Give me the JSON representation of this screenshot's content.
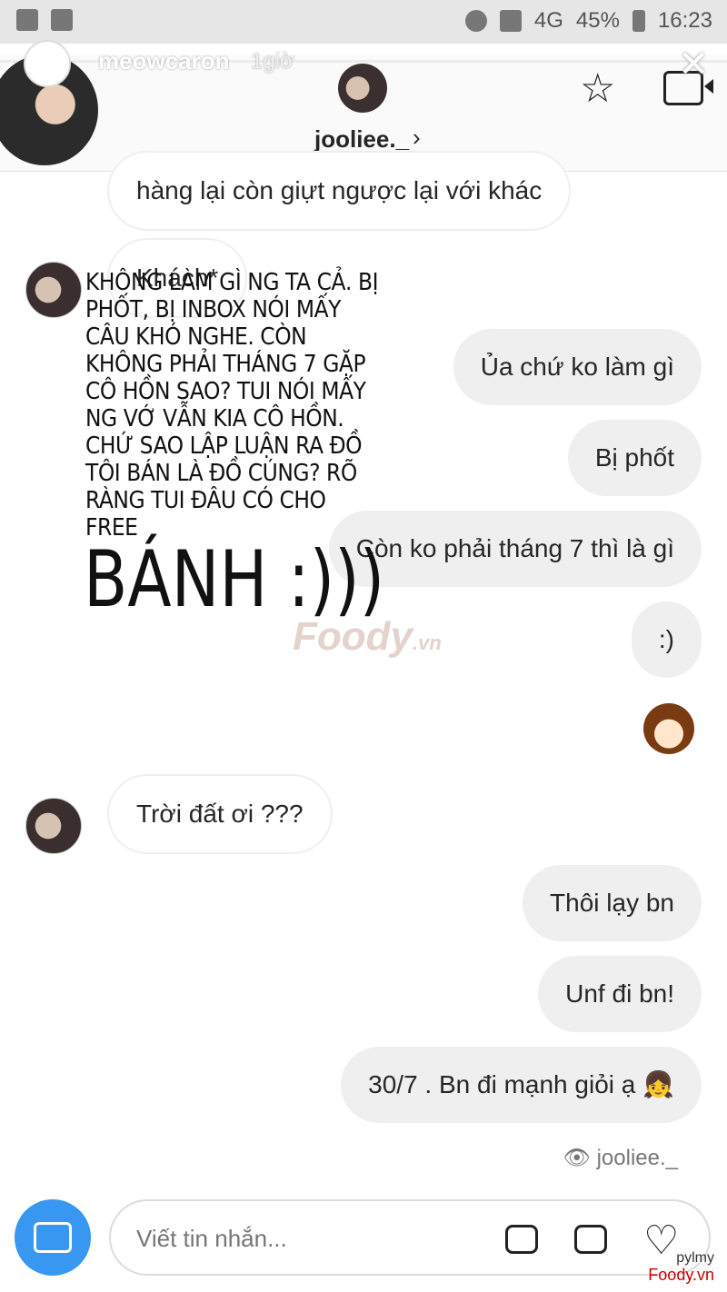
{
  "status_bar": {
    "battery": "45%",
    "time": "16:23",
    "network": "4G"
  },
  "story": {
    "username": "meowcaron",
    "time_ago": "1giờ",
    "close_icon": "close-icon",
    "logo_text": "meowcaron"
  },
  "header": {
    "username": "jooliee._",
    "chevron": "›",
    "star_icon": "star-icon",
    "video_icon": "video-camera-icon"
  },
  "messages": [
    {
      "side": "in",
      "text": "hàng lại còn giựt ngược lại với khác"
    },
    {
      "side": "in",
      "text": "Khách*"
    },
    {
      "side": "out",
      "text": "Ủa chứ ko làm gì"
    },
    {
      "side": "out",
      "text": "Bị phốt"
    },
    {
      "side": "out",
      "text": "Còn ko phải tháng 7 thì là gì"
    },
    {
      "side": "out",
      "text": ":)"
    },
    {
      "side": "out",
      "sticker": "girl-sticker"
    },
    {
      "side": "in",
      "text": "Trời đất ơi ???"
    },
    {
      "side": "out",
      "text": "Thôi lạy bn"
    },
    {
      "side": "out",
      "text": "Unf đi bn!"
    },
    {
      "side": "out",
      "text": "30/7 . Bn đi mạnh giỏi ạ 👧"
    }
  ],
  "overlay": {
    "caption": "Không làm gì ng ta cả. Bị phốt, bị inbox nói mấy câu khó nghe. Còn không phải tháng 7 gặp cô hồn sao? Tui nói mấy ng vớ vẫn kia cô hồn. Chứ sao lập luận ra đồ tôi bán là đồ cúng? Rõ ràng tui đâu có cho free",
    "big": "BÁNH :)))"
  },
  "watermark": {
    "brand": "Foody",
    "suffix": ".vn"
  },
  "seen_by": "jooliee._",
  "composer": {
    "placeholder": "Viết tin nhắn...",
    "camera_icon": "camera-icon",
    "chat_icon": "chat-bubble-icon",
    "image_icon": "image-icon",
    "heart_icon": "heart-icon"
  },
  "corner_logo": {
    "line1": "pylmy",
    "line2": "Foody.vn"
  },
  "colors": {
    "accent": "#3897f0",
    "outgoing_bubble": "#efefef",
    "incoming_border": "#efefef"
  }
}
